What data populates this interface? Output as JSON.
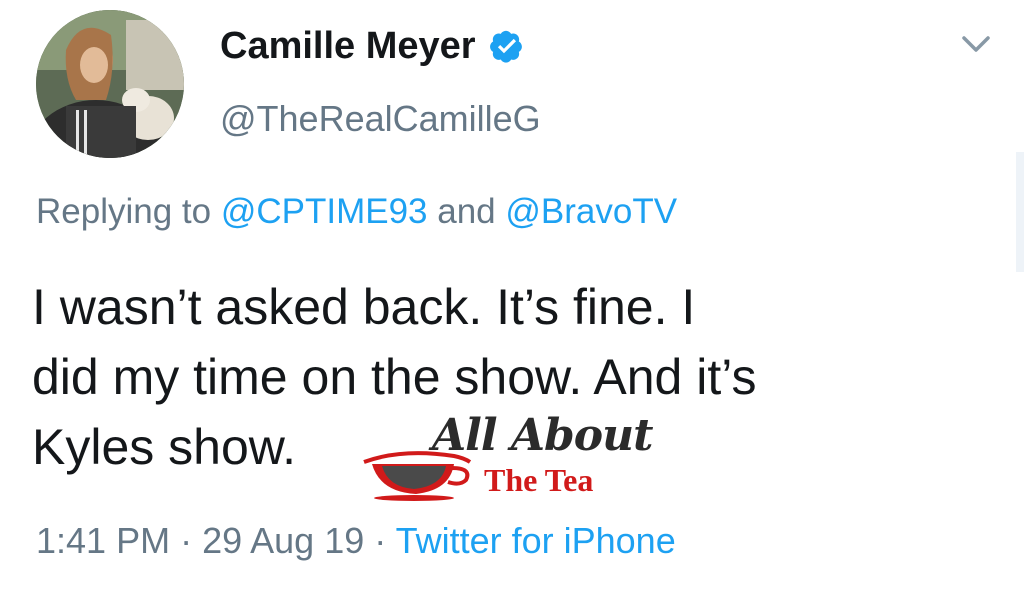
{
  "tweet": {
    "author": {
      "display_name": "Camille Meyer",
      "handle": "@TheRealCamilleG",
      "verified": true
    },
    "reply": {
      "prefix": "Replying to ",
      "mention1": "@CPTIME93",
      "joiner": " and ",
      "mention2": "@BravoTV"
    },
    "text_lines": [
      "I wasn’t asked back. It’s fine. I",
      "did my time on the show. And it’s",
      "Kyles show."
    ],
    "time": "1:41 PM",
    "separator": " · ",
    "date": "29 Aug 19",
    "source": "Twitter for iPhone"
  },
  "watermark": {
    "script": "All About",
    "sub": "The Tea"
  },
  "icons": {
    "verified": "verified-badge-icon",
    "menu": "chevron-down-icon",
    "watermark_cup": "teacup-icon"
  },
  "colors": {
    "name": "#14171a",
    "secondary": "#657786",
    "link": "#1da1f2",
    "verified": "#1da1f2",
    "watermark_red": "#d11a1a"
  }
}
